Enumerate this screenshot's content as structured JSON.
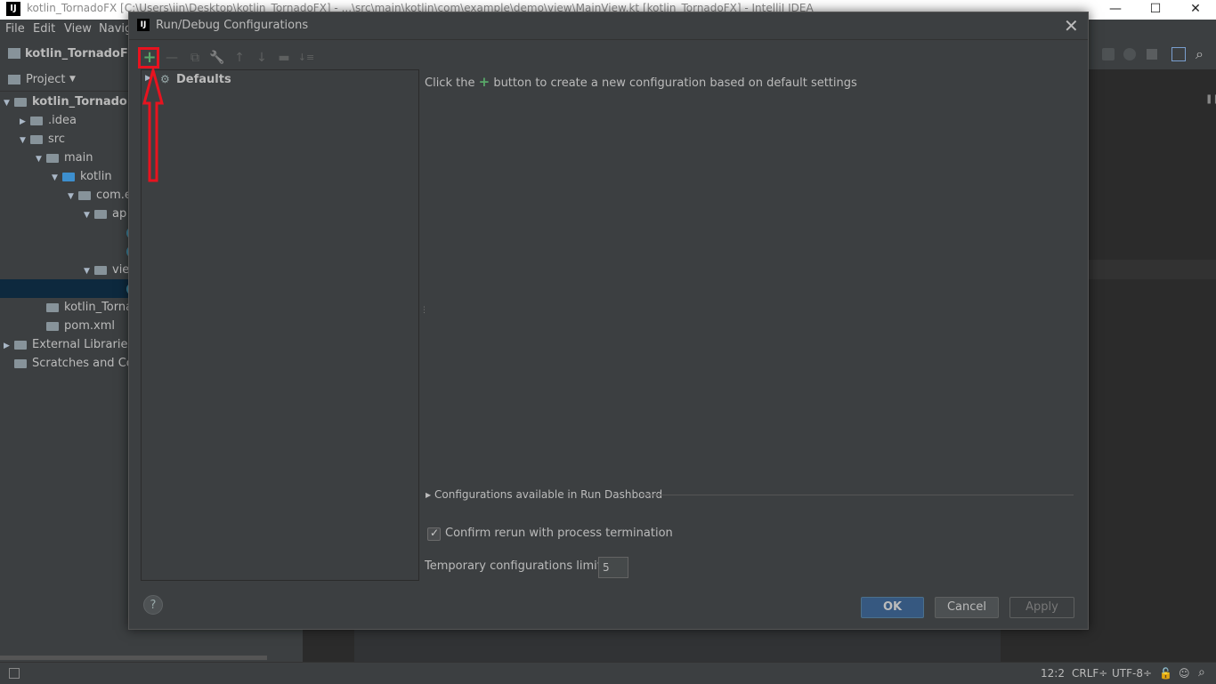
{
  "window": {
    "title": "kotlin_TornadoFX [C:\\Users\\jin\\Desktop\\kotlin_TornadoFX] - ...\\src\\main\\kotlin\\com\\example\\demo\\view\\MainView.kt [kotlin_TornadoFX] - IntelliJ IDEA",
    "logo_text": "IJ",
    "minimize": "—",
    "maximize": "☐",
    "close": "✕"
  },
  "menu": [
    "File",
    "Edit",
    "View",
    "Navig"
  ],
  "navbar": {
    "project_name": "kotlin_TornadoFX"
  },
  "project_panel": {
    "header": "Project",
    "tree": [
      {
        "label": "kotlin_TornadoFX",
        "indent": 0,
        "arrow": "▼",
        "icon": "module-icon",
        "bold": true
      },
      {
        "label": ".idea",
        "indent": 1,
        "arrow": "▶",
        "icon": "folder-icon"
      },
      {
        "label": "src",
        "indent": 1,
        "arrow": "▼",
        "icon": "folder-icon"
      },
      {
        "label": "main",
        "indent": 2,
        "arrow": "▼",
        "icon": "folder-icon"
      },
      {
        "label": "kotlin",
        "indent": 3,
        "arrow": "▼",
        "icon": "blue-folder-icon"
      },
      {
        "label": "com.e",
        "indent": 4,
        "arrow": "▼",
        "icon": "package-icon"
      },
      {
        "label": "ap",
        "indent": 5,
        "arrow": "▼",
        "icon": "package-icon"
      },
      {
        "label": "",
        "indent": 7,
        "arrow": "",
        "icon": "kotlin-file-icon"
      },
      {
        "label": "",
        "indent": 7,
        "arrow": "",
        "icon": "kotlin-file-icon"
      },
      {
        "label": "vie",
        "indent": 5,
        "arrow": "▼",
        "icon": "package-icon"
      },
      {
        "label": "",
        "indent": 7,
        "arrow": "",
        "icon": "kotlin-file-icon",
        "selected": true
      },
      {
        "label": "kotlin_Tornado",
        "indent": 2,
        "arrow": "",
        "icon": "iml-file-icon"
      },
      {
        "label": "pom.xml",
        "indent": 2,
        "arrow": "",
        "icon": "maven-icon"
      },
      {
        "label": "External Libraries",
        "indent": 0,
        "arrow": "▶",
        "icon": "libraries-icon"
      },
      {
        "label": "Scratches and Cor",
        "indent": 0,
        "arrow": "",
        "icon": "scratches-icon"
      }
    ]
  },
  "status_bar": {
    "position": "12:2",
    "line_sep": "CRLF÷",
    "encoding": "UTF-8÷"
  },
  "dialog": {
    "title": "Run/Debug Configurations",
    "logo_text": "IJ",
    "close": "✕",
    "toolbar": {
      "add": "+",
      "remove": "—",
      "copy": "⧉",
      "edit_defaults": "🔧",
      "move_up": "↑",
      "move_down": "↓",
      "folder": "▬",
      "sort": "↓≡"
    },
    "tree": {
      "defaults_label": "Defaults",
      "arrow": "▶"
    },
    "hint": {
      "prefix": "Click the",
      "plus": "+",
      "suffix": "button to create a new configuration based on default settings"
    },
    "run_dashboard": "Configurations available in Run Dashboard",
    "confirm_rerun": {
      "label": "Confirm rerun with process termination",
      "checked": true
    },
    "temp_limit": {
      "label": "Temporary configurations limit:",
      "value": "5"
    },
    "help": "?",
    "buttons": {
      "ok": "OK",
      "cancel": "Cancel",
      "apply": "Apply"
    }
  },
  "colors": {
    "accent_ok": "#365880",
    "plus_green": "#59a869",
    "annotation_red": "#e8131f"
  }
}
